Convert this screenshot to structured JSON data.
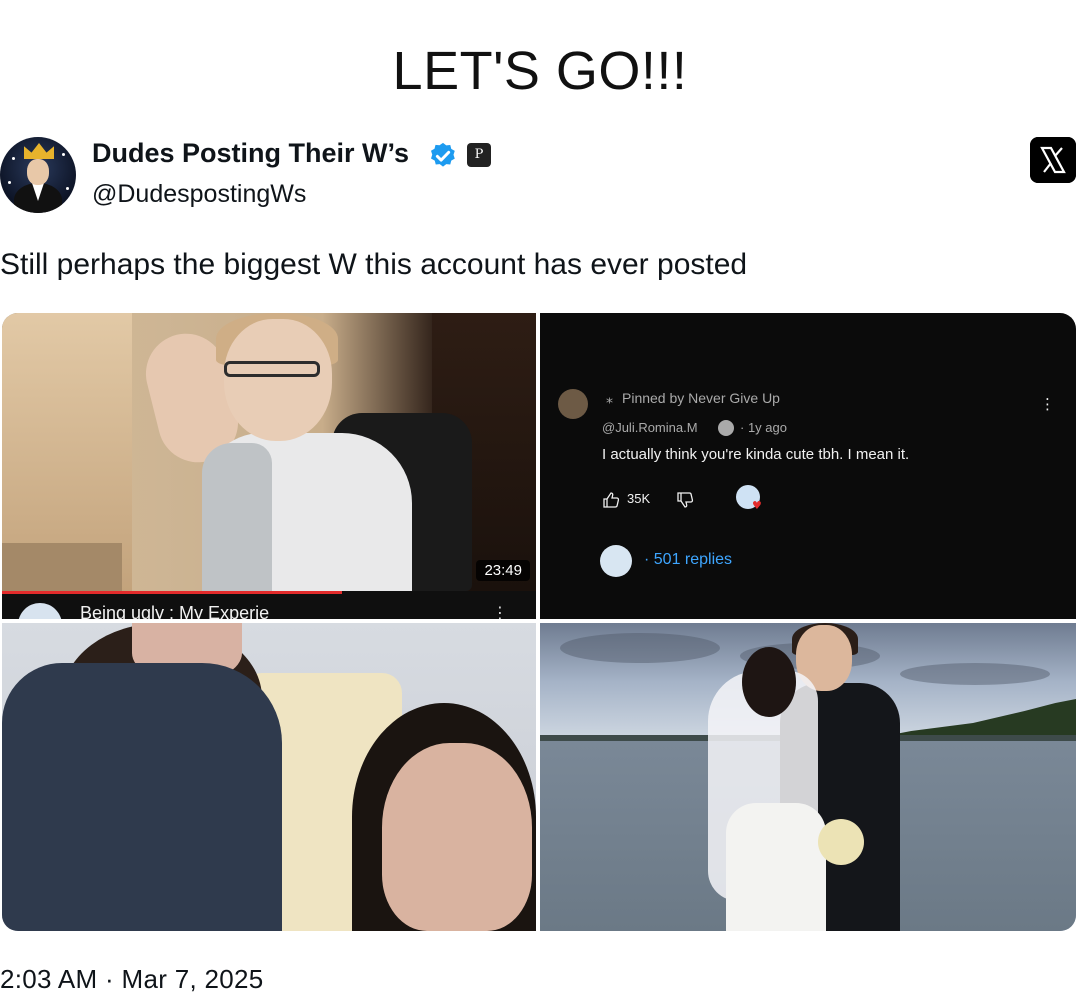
{
  "meme": {
    "headline": "LET'S GO!!!"
  },
  "tweet": {
    "author": {
      "display_name": "Dudes Posting Their W’s",
      "handle": "@DudespostingWs",
      "verified_icon": "verified-badge-icon",
      "affiliate_icon": "affiliate-badge-icon"
    },
    "platform_icon": "x-logo-icon",
    "text": "Still perhaps the biggest W this account has ever posted",
    "timestamp": "2:03 AM · Mar 7, 2025",
    "media": {
      "video": {
        "duration": "23:49",
        "title": "Being ugly : My Experie"
      },
      "comment": {
        "pinned": "Pinned by Never Give Up",
        "author": "@Juli.Romina.M",
        "time": "· 1y ago",
        "text": "I actually think you're kinda cute tbh. I mean it.",
        "likes": "35K",
        "replies": "· 501 replies",
        "reply_color": "#3ea6ff"
      }
    }
  },
  "colors": {
    "verified_blue": "#1d9bf0",
    "accent_red": "#e32b2b"
  }
}
